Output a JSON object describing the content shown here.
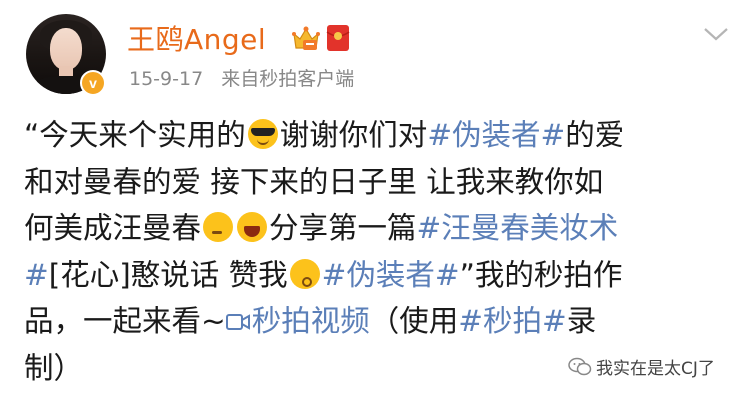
{
  "header": {
    "username": "王鸥Angel",
    "date": "15-9-17",
    "source": "来自秒拍客户端"
  },
  "post": {
    "l1a": "“今天来个实用的",
    "l1b": "谢谢你们对",
    "l1c": "#伪装者#",
    "l1d": "的爱",
    "l2": "和对曼春的爱 接下来的日子里 让我来教你如",
    "l3a": "何美成汪曼春",
    "l3b": "分享第一篇",
    "l3c": "#汪曼春美妆术",
    "l4a": "#",
    "l4b": "[花心]憨说话 赞我",
    "l4c": "#伪装者#",
    "l4d": "”我的秒拍作",
    "l5a": "品，一起来看~",
    "l5b": "秒拍视频",
    "l5c": "（使用",
    "l5d": "#秒拍#",
    "l5e": "录",
    "l6": "制）"
  },
  "icons": {
    "verified": "verified-v-badge",
    "vip": "crown-icon",
    "red_packet": "red-packet-icon",
    "more": "chevron-down-icon",
    "video": "video-icon"
  },
  "watermark": {
    "text": "我实在是太CJ了"
  },
  "colors": {
    "username": "#e86a1a",
    "meta": "#888888",
    "topic": "#5b7fb8",
    "text": "#1a1a1a",
    "badge": "#f5a623"
  }
}
